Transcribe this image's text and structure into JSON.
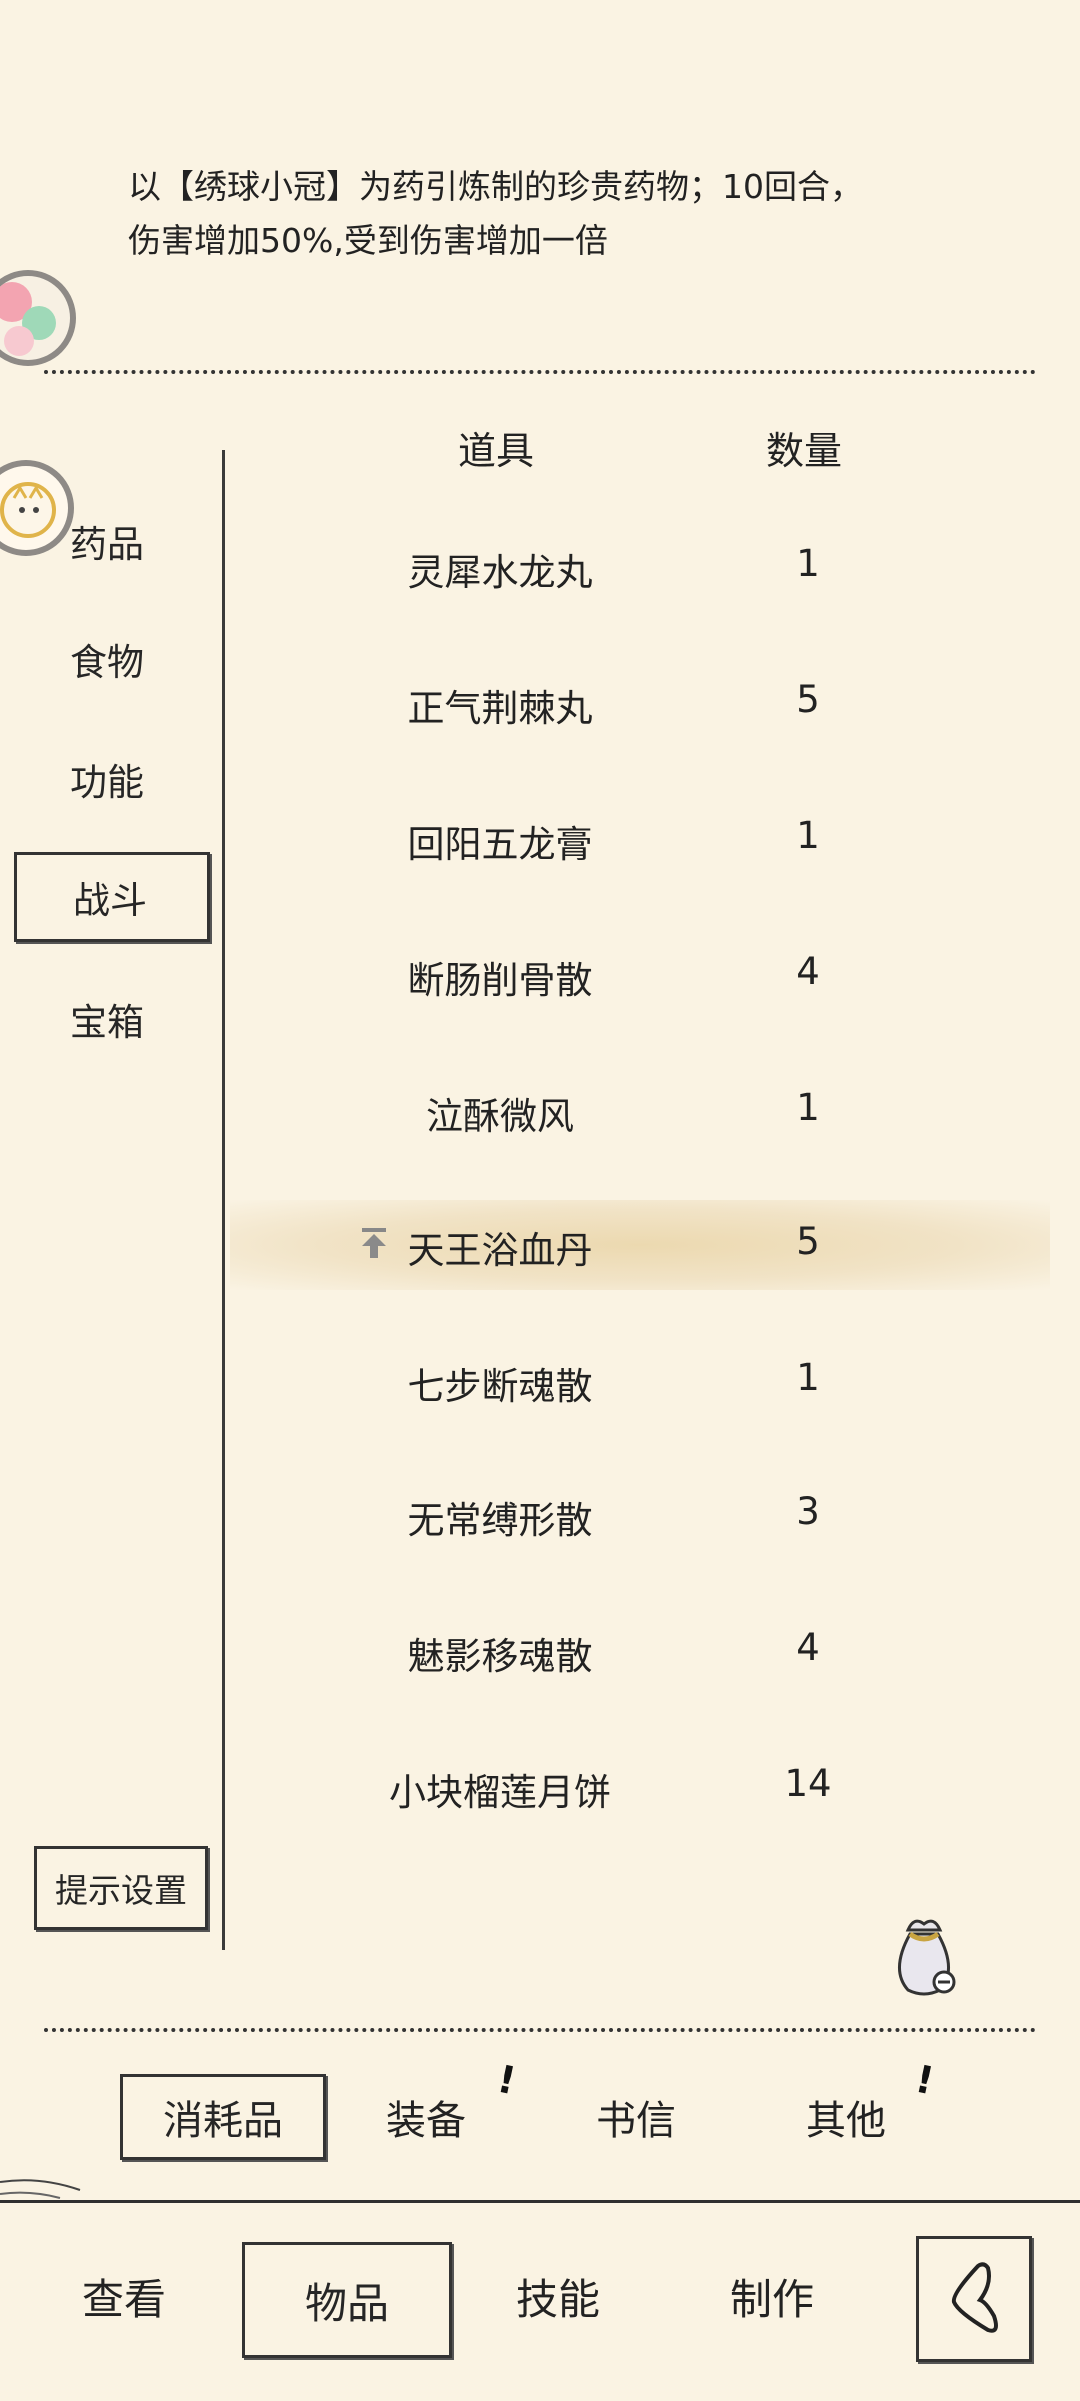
{
  "description": {
    "line1": "以【绣球小冠】为药引炼制的珍贵药物；10回合，",
    "line2": "伤害增加50%,受到伤害增加一倍"
  },
  "table": {
    "header_item": "道具",
    "header_qty": "数量",
    "rows": [
      {
        "name": "灵犀水龙丸",
        "qty": "1"
      },
      {
        "name": "正气荆棘丸",
        "qty": "5"
      },
      {
        "name": "回阳五龙膏",
        "qty": "1"
      },
      {
        "name": "断肠削骨散",
        "qty": "4"
      },
      {
        "name": "泣酥微风",
        "qty": "1"
      },
      {
        "name": "天王浴血丹",
        "qty": "5",
        "selected": true
      },
      {
        "name": "七步断魂散",
        "qty": "1"
      },
      {
        "name": "无常缚形散",
        "qty": "3"
      },
      {
        "name": "魅影移魂散",
        "qty": "4"
      },
      {
        "name": "小块榴莲月饼",
        "qty": "14"
      }
    ]
  },
  "categories": [
    "药品",
    "食物",
    "功能",
    "战斗",
    "宝箱"
  ],
  "active_category": "战斗",
  "hint_settings": "提示设置",
  "sub_tabs": [
    "消耗品",
    "装备",
    "书信",
    "其他"
  ],
  "bottom_nav": [
    "查看",
    "物品",
    "技能",
    "制作"
  ],
  "icons": {
    "bag": "money-bag-icon",
    "back": "back-arrow-icon",
    "top_badge": "colorful-orb-icon",
    "side_badge": "cat-avatar-icon",
    "pin": "pin-to-top-icon"
  }
}
